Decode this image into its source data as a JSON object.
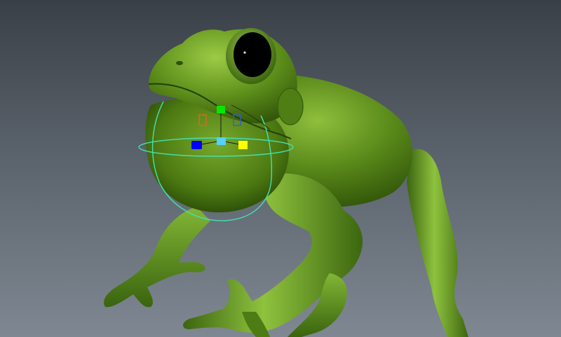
{
  "viewport": {
    "background_top": "#3a4047",
    "background_bottom": "#7f8892"
  },
  "model": {
    "icon": "frog-model",
    "skin_color": "#5a8a1a",
    "skin_shadow": "#2f5208",
    "skin_highlight": "#a7cf58",
    "eye_color": "#000000"
  },
  "manipulator": {
    "icon": "rotate-scale-manipulator",
    "ring_color": "#44e0b0",
    "handles": [
      {
        "name": "y-axis-handle",
        "color": "#00e800"
      },
      {
        "name": "x-axis-handle",
        "color": "#0000ff"
      },
      {
        "name": "z-axis-handle",
        "color": "#ffff00"
      },
      {
        "name": "center-handle",
        "color": "#55d0ff"
      },
      {
        "name": "plane-handle-xy",
        "color": "#d86a20"
      },
      {
        "name": "plane-handle-yz",
        "color": "#3a5ad0"
      }
    ]
  }
}
